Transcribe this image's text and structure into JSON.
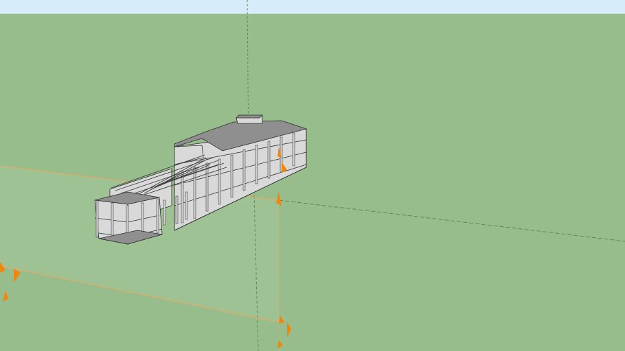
{
  "viewport": {
    "sky_color": "#d6ecfa",
    "ground_color": "#98bd8c",
    "ground_light_color": "#a6c79b",
    "axis_green_color": "#5a8a50",
    "axis_orange_color": "#f2a65a",
    "section_plane_color": "#f0860c"
  },
  "model": {
    "slab_color": "#8f8f8f",
    "slab_side_color": "#d9d9d9",
    "column_color": "#cfcfcf",
    "edge_color": "#2b2b2b",
    "rebar_color": "#3a3a3a"
  },
  "tools": {
    "axes_icon": "axes-icon",
    "section_plane_icon": "section-plane-icon"
  }
}
